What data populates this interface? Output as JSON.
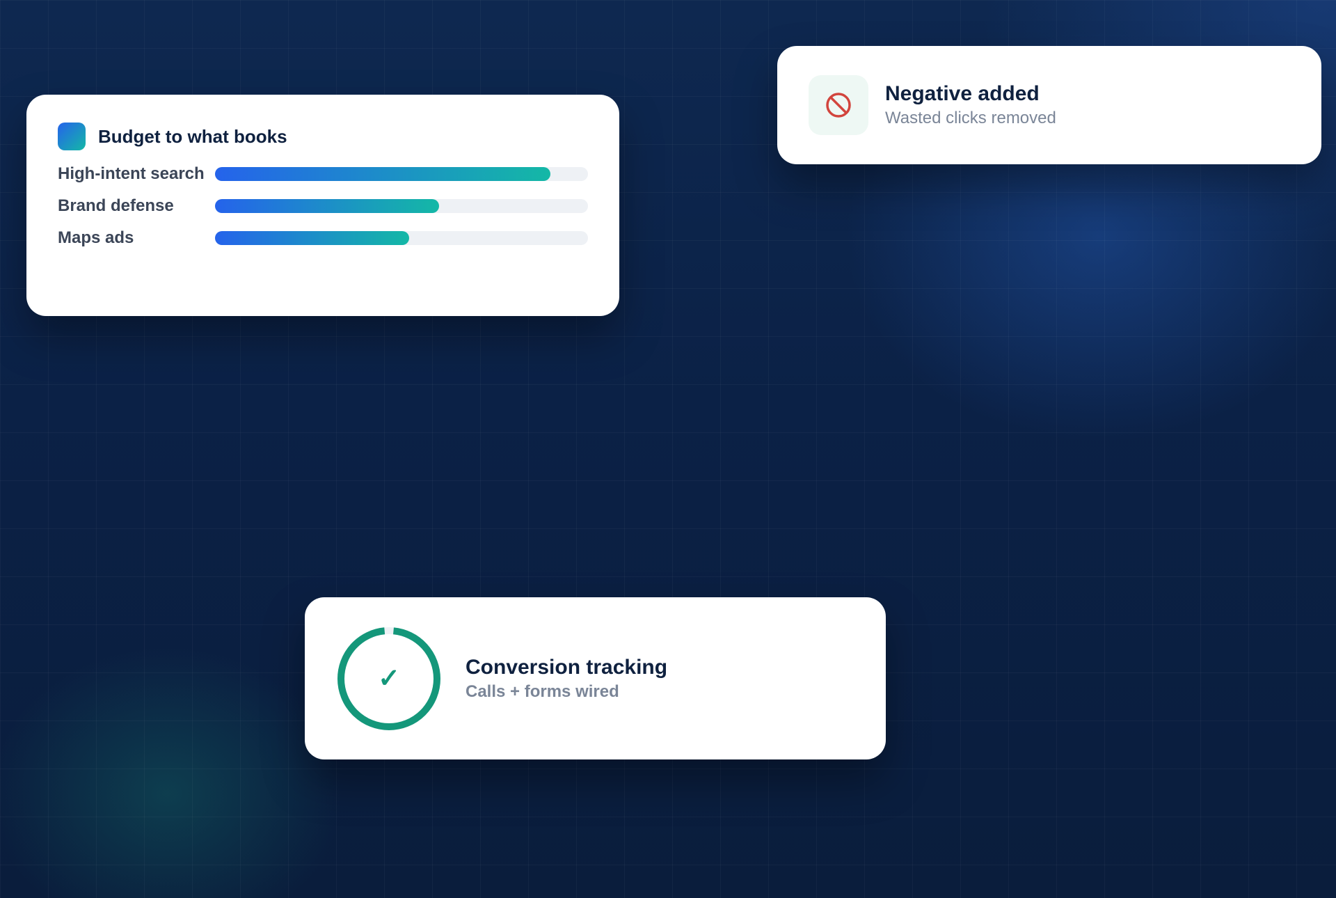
{
  "budget_card": {
    "title": "Budget to what books",
    "bars": [
      {
        "label": "High-intent search",
        "value": 0.9
      },
      {
        "label": "Brand defense",
        "value": 0.6
      },
      {
        "label": "Maps ads",
        "value": 0.52
      }
    ]
  },
  "negative_card": {
    "icon": "no-entry-icon",
    "title": "Negative added",
    "subtitle": "Wasted clicks removed"
  },
  "conversion_card": {
    "icon": "checkmark-icon",
    "check": "✓",
    "progress": 0.97,
    "title": "Conversion tracking",
    "subtitle": "Calls + forms wired"
  },
  "colors": {
    "background": "#0b2146",
    "bar_gradient_start": "#2563eb",
    "bar_gradient_end": "#14b8a6",
    "ring": "#14977a",
    "blocked_icon": "#d2453d",
    "title_text": "#0f213f",
    "muted_text": "#7a8597"
  }
}
